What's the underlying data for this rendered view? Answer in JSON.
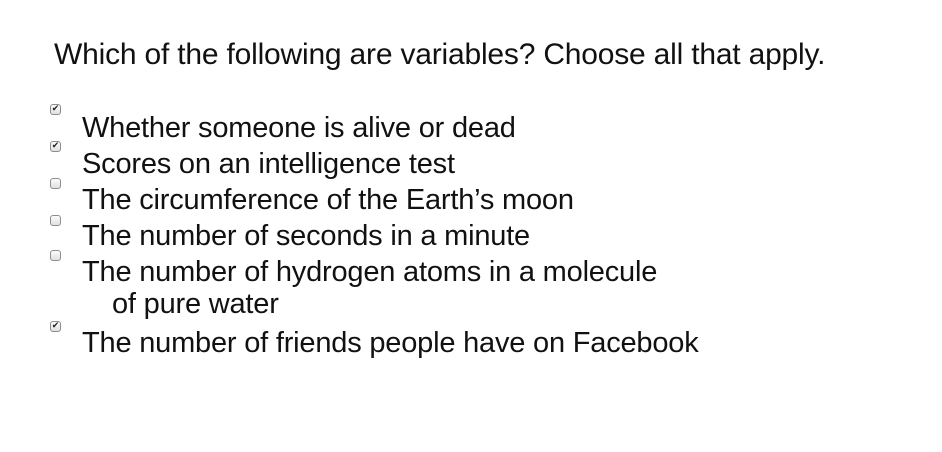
{
  "question": "Which of the following are variables? Choose all that apply.",
  "options": [
    {
      "label": "Whether someone is alive or dead",
      "label_cont": "",
      "checked": true
    },
    {
      "label": "Scores on an intelligence test",
      "label_cont": "",
      "checked": true
    },
    {
      "label": "The circumference of the Earth’s moon",
      "label_cont": "",
      "checked": false
    },
    {
      "label": "The number of seconds in a minute",
      "label_cont": "",
      "checked": false
    },
    {
      "label": "The number of hydrogen atoms in a molecule",
      "label_cont": "of pure water",
      "checked": false
    },
    {
      "label": "The number of friends people have on Facebook",
      "label_cont": "",
      "checked": true
    }
  ],
  "check_glyph": "✔"
}
